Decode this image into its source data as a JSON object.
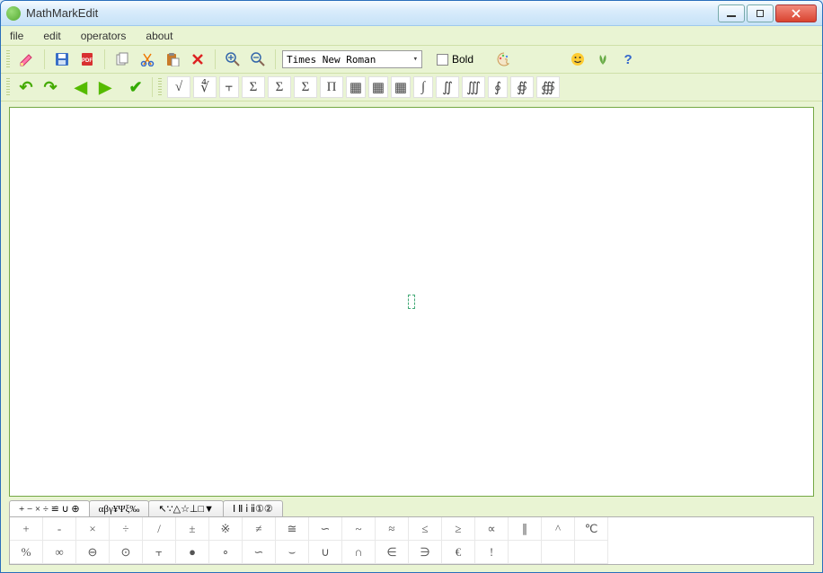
{
  "window": {
    "title": "MathMarkEdit"
  },
  "menu": {
    "file": "file",
    "edit": "edit",
    "operators": "operators",
    "about": "about"
  },
  "toolbar": {
    "font": "Times New Roman",
    "bold_label": "Bold"
  },
  "operators_row": [
    "√",
    "∜",
    "⫟",
    "Σ",
    "Σ",
    "Σ",
    "Π",
    "▦",
    "▦",
    "▦",
    "∫",
    "∬",
    "∭",
    "∮",
    "∯",
    "∰"
  ],
  "tabs": {
    "t0": "+ − × ÷ ≌ ∪ ⊕",
    "t1": "αβγ¥Ψξ‰",
    "t2": "↖∵△☆⊥□▼",
    "t3": "Ⅰ Ⅱ ⅰ ⅱ①②"
  },
  "symbols": {
    "row1": [
      "+",
      "-",
      "×",
      "÷",
      "/",
      "±",
      "※",
      "≠",
      "≅",
      "∽",
      "~",
      "≈",
      "≤",
      "≥",
      "∝",
      "∥",
      "^",
      "℃"
    ],
    "row2": [
      "%",
      "∞",
      "⊖",
      "⊙",
      "⫟",
      "●",
      "∘",
      "∽",
      "⌣",
      "∪",
      "∩",
      "∈",
      "∋",
      "€",
      "!",
      "",
      "",
      ""
    ]
  }
}
